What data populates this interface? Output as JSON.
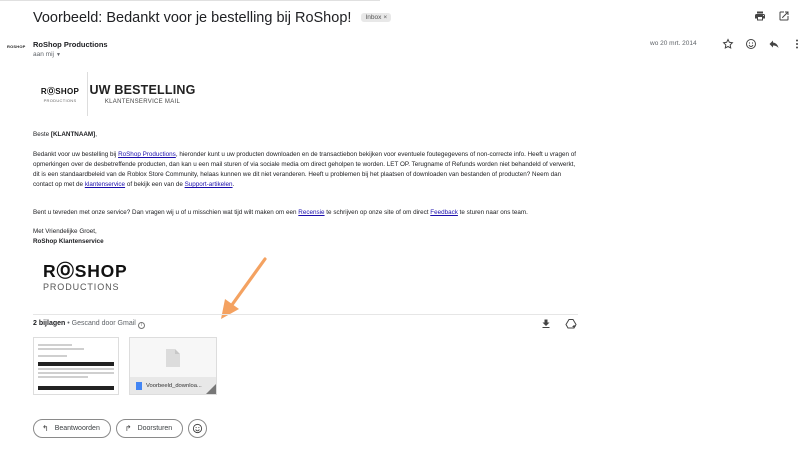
{
  "email": {
    "subject": "Voorbeeld: Bedankt voor je bestelling bij RoShop!",
    "label_chip": "Inbox",
    "sender_logo_text": "ROSHOP",
    "sender_name": "RoShop Productions",
    "to_label": "aan mij",
    "date": "wo 20 mrt. 2014"
  },
  "top_icons": [
    "print-icon",
    "open-in-new-window-icon"
  ],
  "row_icons": [
    "star-icon",
    "emoji-reaction-icon",
    "reply-icon",
    "more-vert-icon"
  ],
  "banner": {
    "logo_main": "RⓄSHOP",
    "logo_sub": "PRODUCTIONS",
    "title": "UW BESTELLING",
    "subtitle": "KLANTENSERVICE MAIL"
  },
  "body": {
    "greeting_prefix": "Beste ",
    "greeting_name": "[KLANTNAAM]",
    "greeting_suffix": ",",
    "p1_a": "Bedankt voor uw bestelling bij ",
    "p1_link1": "RoShop Productions",
    "p1_b": ", hieronder kunt u uw producten downloaden en de transactiebon bekijken voor eventuele foutegegevens of non-correcte info. Heeft u vragen of opmerkingen over de desbetreffende producten, dan kan u een mail sturen of via sociale media om direct geholpen te worden. LET OP. Terugname of Refunds worden niet behandeld of verwerkt, dit is een standaardbeleid van de Roblox Store Community, helaas kunnen we dit niet veranderen. Heeft u problemen bij het plaatsen of downloaden van bestanden of producten? Neem dan contact op met de ",
    "p1_link2": "klantenservice",
    "p1_c": " of bekijk een van de ",
    "p1_link3": "Support-artikelen",
    "p1_d": ".",
    "p2_a": "Bent u tevreden met onze service? Dan vragen wij u of u misschien wat tijd wilt maken om een ",
    "p2_link1": "Recensie",
    "p2_b": " te schrijven op onze site of om direct ",
    "p2_link2": "Feedback",
    "p2_c": " te sturen naar ons team.",
    "sign_line1": "Met Vriendelijke Groet,",
    "sign_line2": "RoShop Klantenservice",
    "footer_logo_main": "RⓄSHOP",
    "footer_logo_sub": "PRODUCTIONS"
  },
  "attachments": {
    "count_label": "2 bijlagen",
    "scan_label": " • Gescand door Gmail ",
    "info_glyph": "i",
    "files": [
      {
        "name": "",
        "kind": "pdf-preview"
      },
      {
        "name": "Voorbeeld_downloa...",
        "kind": "document"
      }
    ]
  },
  "actions": {
    "reply": "Beantwoorden",
    "forward": "Doorsturen"
  },
  "colors": {
    "link": "#1a0dab",
    "arrow": "#f4a261",
    "file_icon": "#4285f4"
  }
}
